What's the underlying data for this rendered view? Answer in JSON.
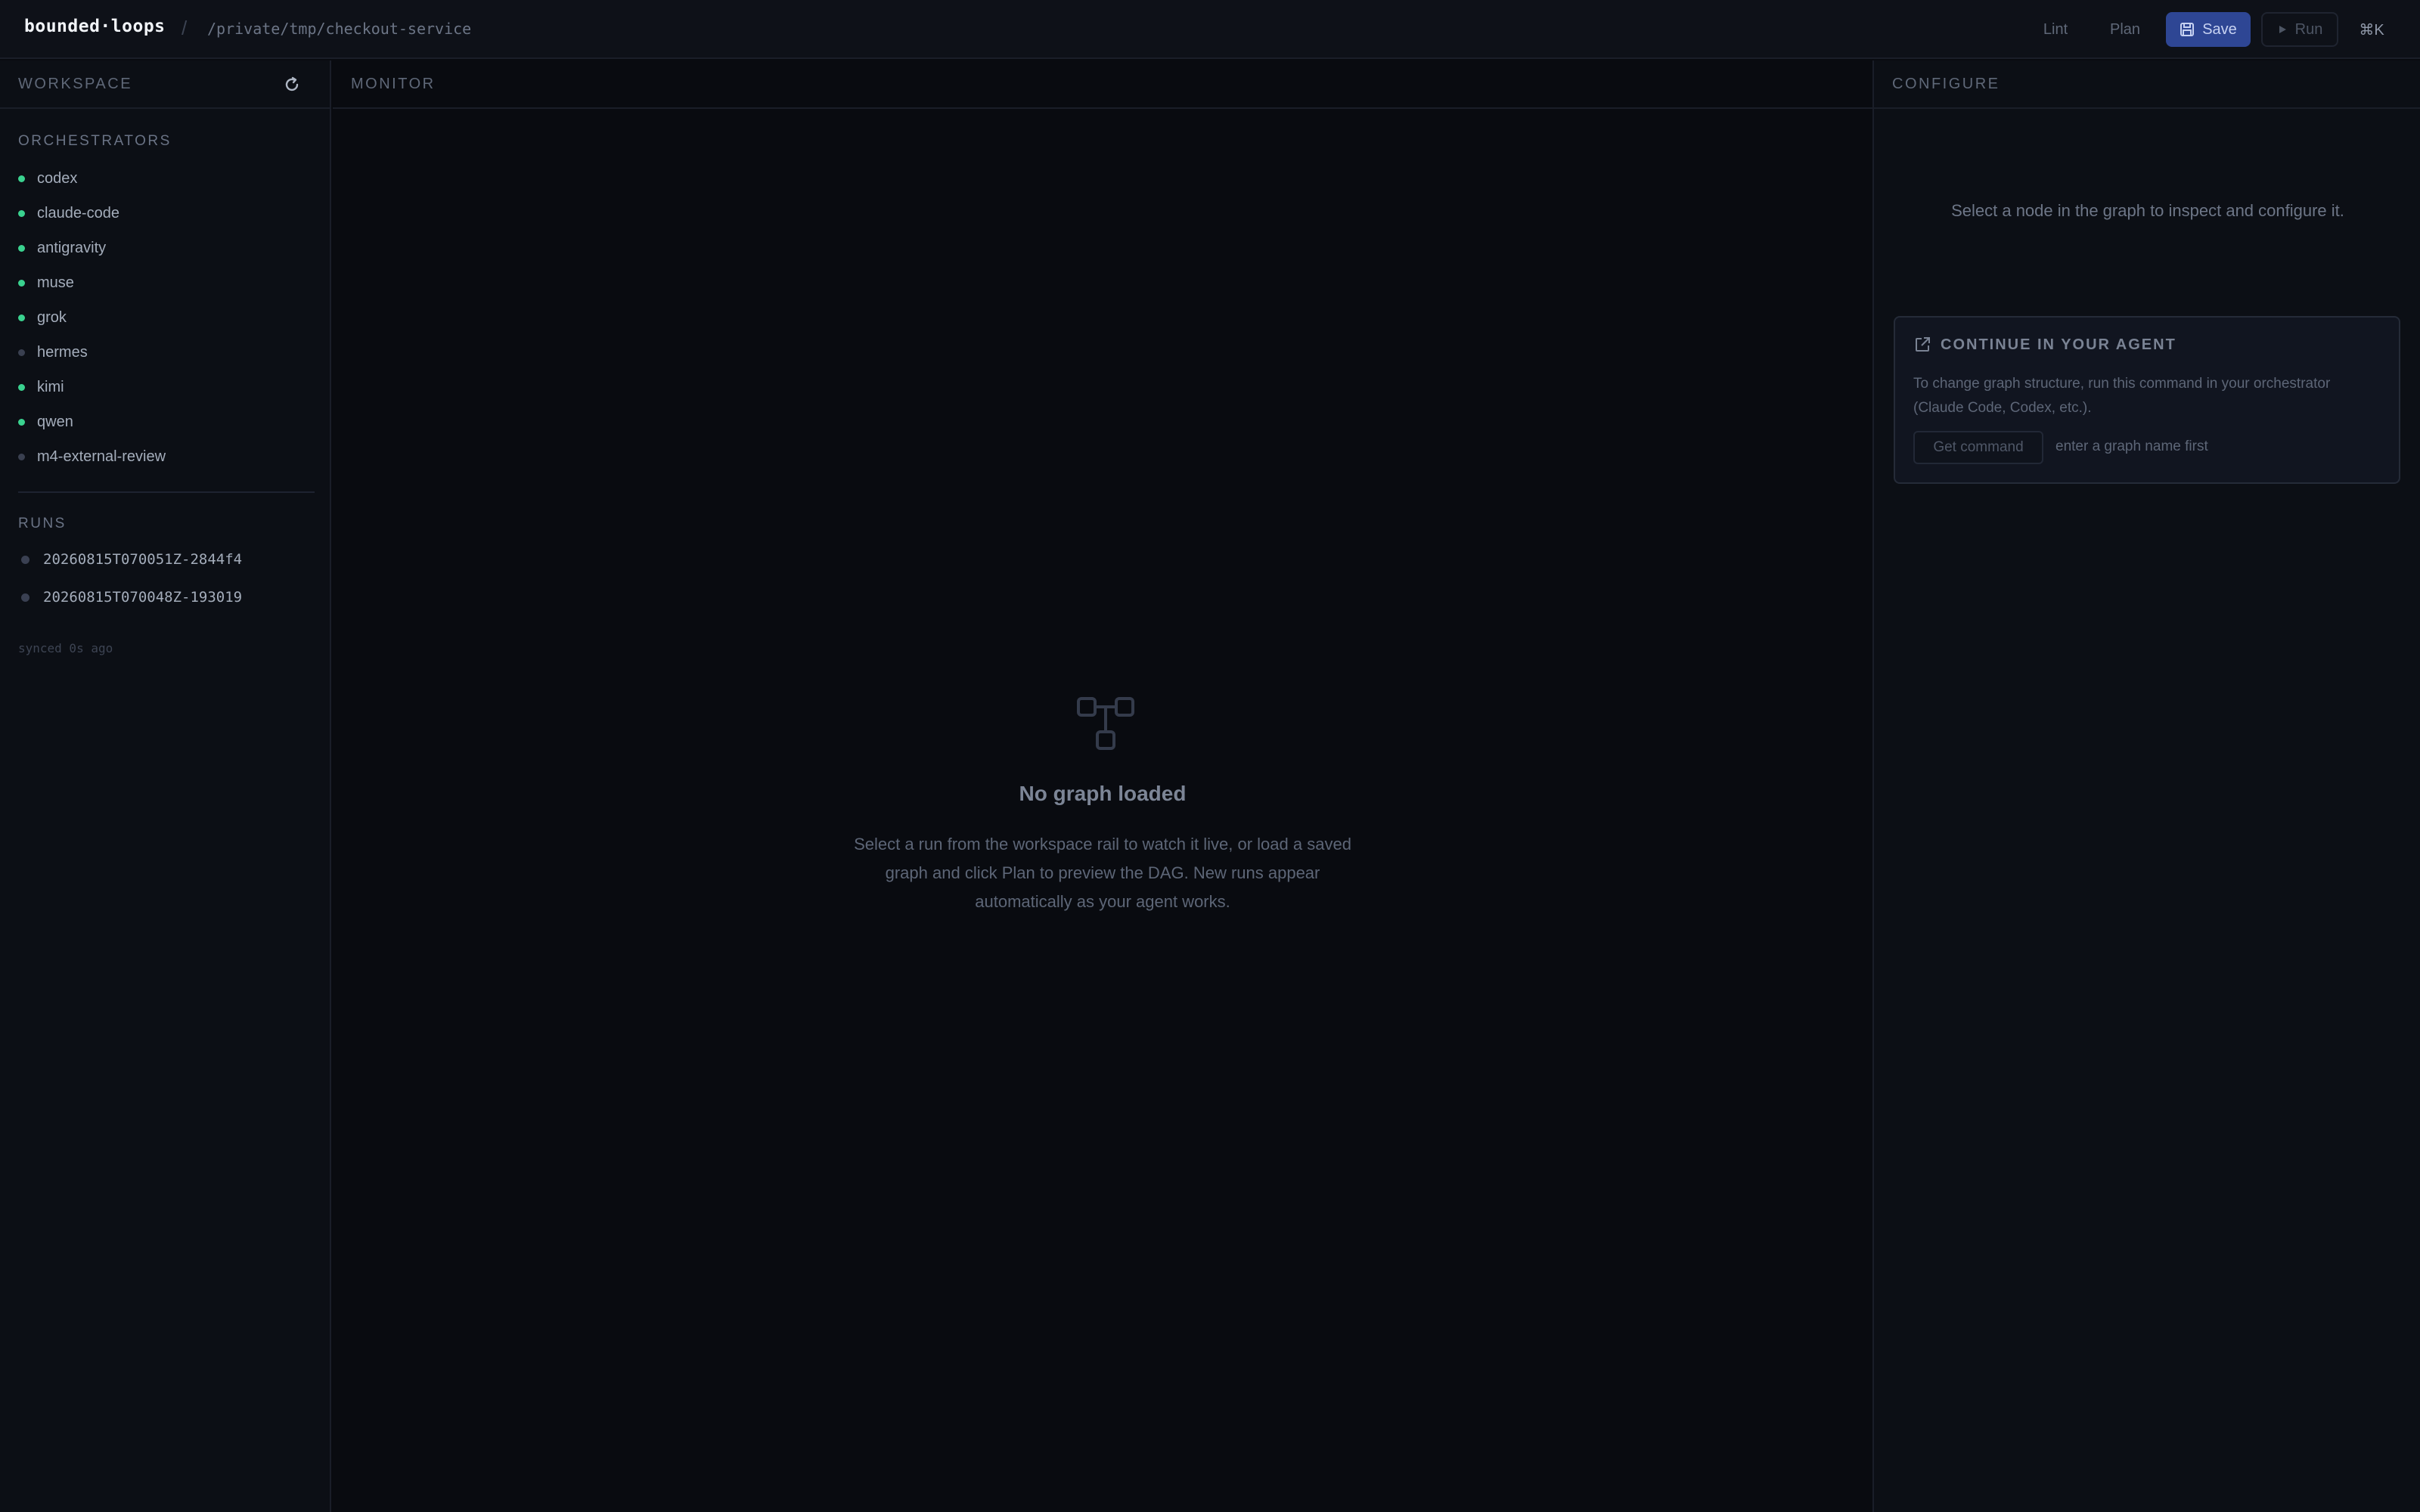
{
  "header": {
    "brand": "bounded·loops",
    "separator": "/",
    "path": "/private/tmp/checkout-service",
    "actions": {
      "lint": "Lint",
      "plan": "Plan",
      "save": "Save",
      "run": "Run",
      "shortcut": "⌘K"
    }
  },
  "workspace": {
    "title": "WORKSPACE",
    "orchestrators_label": "ORCHESTRATORS",
    "orchestrators": [
      {
        "name": "codex",
        "active": true
      },
      {
        "name": "claude-code",
        "active": true
      },
      {
        "name": "antigravity",
        "active": true
      },
      {
        "name": "muse",
        "active": true
      },
      {
        "name": "grok",
        "active": true
      },
      {
        "name": "hermes",
        "active": false
      },
      {
        "name": "kimi",
        "active": true
      },
      {
        "name": "qwen",
        "active": true
      },
      {
        "name": "m4-external-review",
        "active": false
      }
    ],
    "runs_label": "RUNS",
    "runs": [
      "20260815T070051Z-2844f4",
      "20260815T070048Z-193019"
    ],
    "synced": "synced 0s ago"
  },
  "monitor": {
    "title": "MONITOR",
    "empty_title": "No graph loaded",
    "empty_body": "Select a run from the workspace rail to watch it live, or load a saved graph and click Plan to preview the DAG. New runs appear automatically as your agent works."
  },
  "configure": {
    "title": "CONFIGURE",
    "hint": "Select a node in the graph to inspect and configure it.",
    "card_title": "CONTINUE IN YOUR AGENT",
    "card_body": "To change graph structure, run this command in your orchestrator (Claude Code, Codex, etc.).",
    "get_command": "Get command",
    "command_hint": "enter a graph name first"
  },
  "colors": {
    "active_dot": "#3ad28f",
    "inactive_dot": "#3a4050",
    "save_button": "#2e4694"
  }
}
